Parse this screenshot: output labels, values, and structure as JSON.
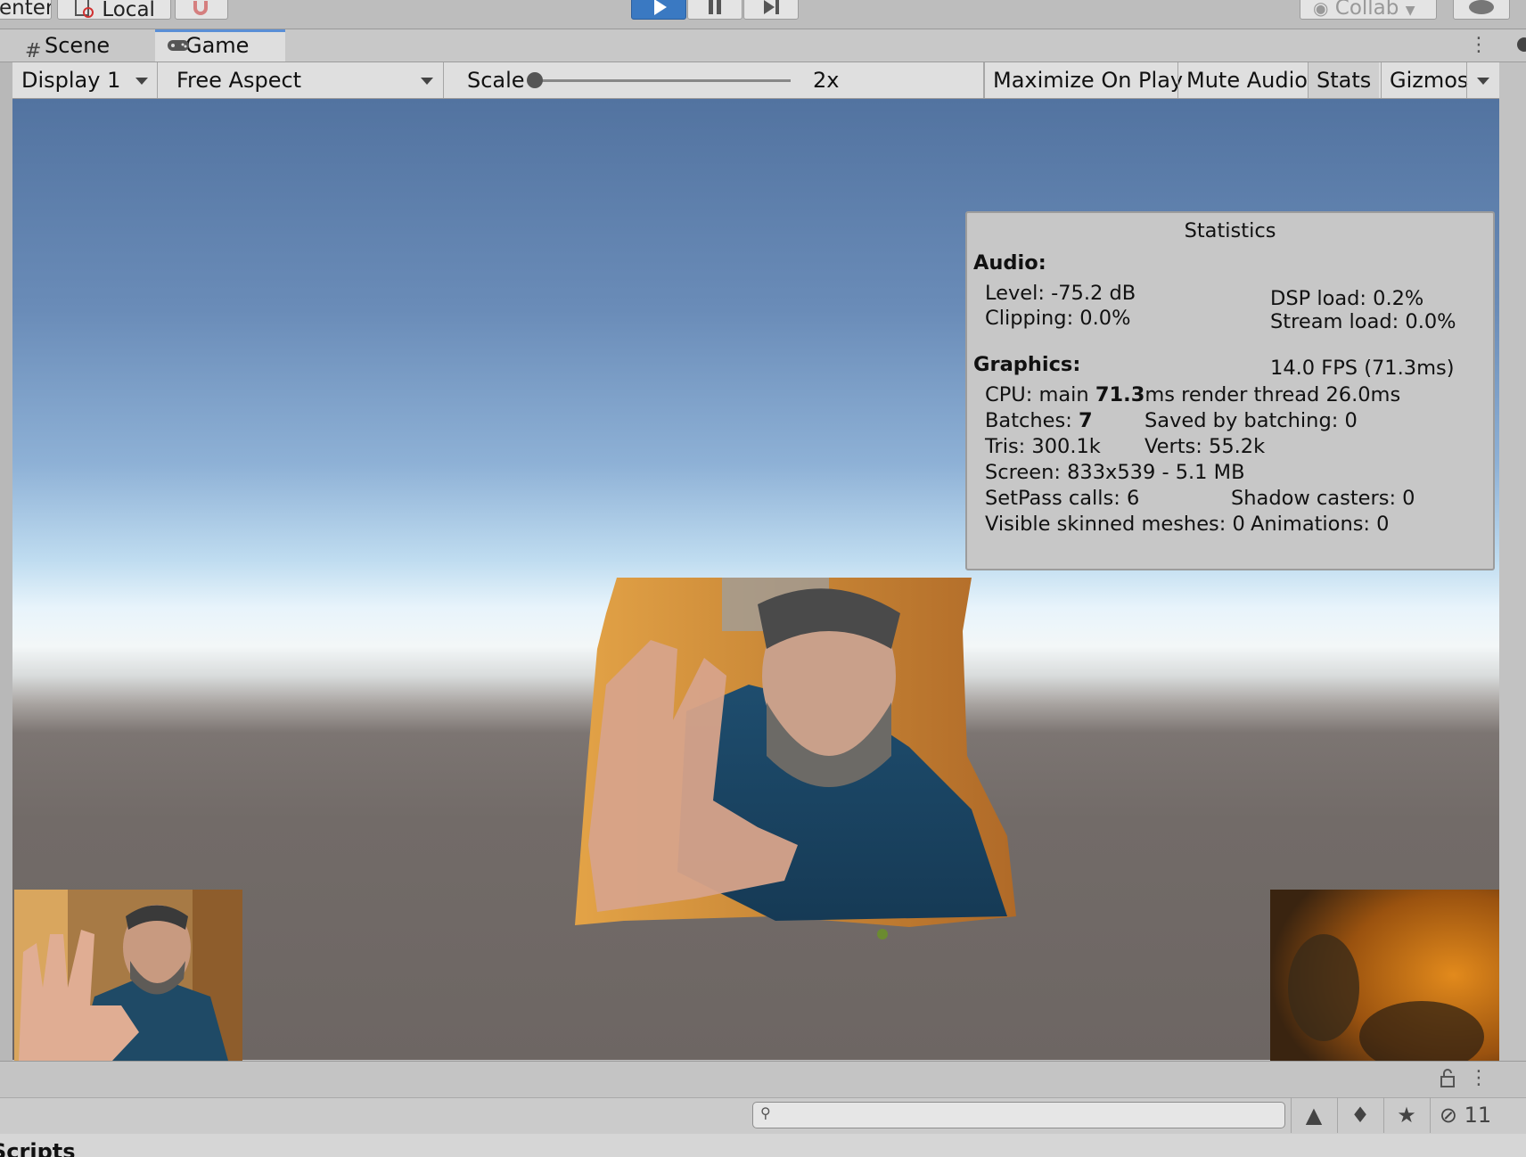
{
  "toolbar": {
    "pivot_label": "enter",
    "space_label": "Local",
    "collab_label": "Collab"
  },
  "tabs": [
    {
      "label": "Scene",
      "icon": "hash-grid-icon"
    },
    {
      "label": "Game",
      "icon": "gamepad-icon"
    }
  ],
  "game_controls": {
    "display": "Display 1",
    "aspect": "Free Aspect",
    "scale_label": "Scale",
    "scale_value": "2x",
    "maximize": "Maximize On Play",
    "mute": "Mute Audio",
    "stats": "Stats",
    "gizmos": "Gizmos"
  },
  "statistics": {
    "title": "Statistics",
    "audio_header": "Audio:",
    "level": "Level: -75.2 dB",
    "clipping": "Clipping: 0.0%",
    "dsp": "DSP load: 0.2%",
    "stream": "Stream load: 0.0%",
    "graphics_header": "Graphics:",
    "fps": "14.0 FPS (71.3ms)",
    "cpu_prefix": "CPU: main ",
    "cpu_main": "71.3",
    "cpu_suffix": "ms  render thread 26.0ms",
    "batches_prefix": "Batches: ",
    "batches": "7",
    "saved": "Saved by batching: 0",
    "tris": "Tris: 300.1k",
    "verts": "Verts: 55.2k",
    "screen": "Screen: 833x539 - 5.1 MB",
    "setpass": "SetPass calls: 6",
    "shadow": "Shadow casters: 0",
    "skinned": "Visible skinned meshes: 0",
    "animations": "Animations: 0"
  },
  "bottom": {
    "hidden_count": "11",
    "folder_label": "Scripts"
  },
  "colors": {
    "play_active": "#3a79c2",
    "tab_accent": "#5a8fd6",
    "panel_bg": "#c7c7c7"
  }
}
